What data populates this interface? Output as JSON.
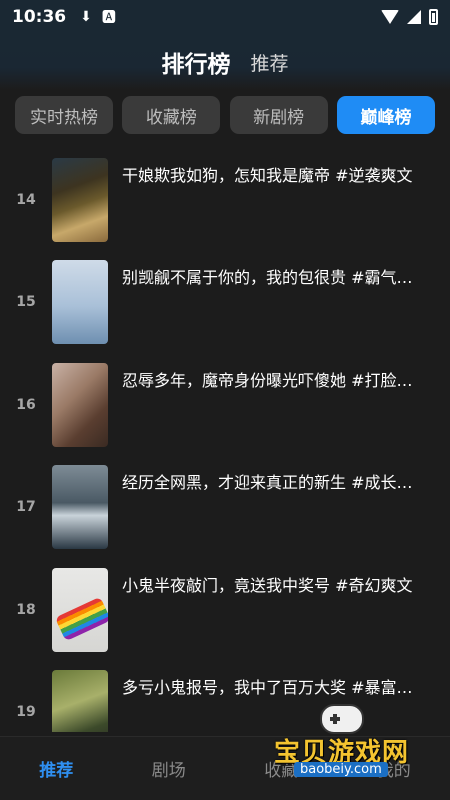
{
  "status": {
    "time": "10:36"
  },
  "header": {
    "title": "排行榜",
    "tab2": "推荐"
  },
  "chips": [
    {
      "label": "实时热榜",
      "active": false
    },
    {
      "label": "收藏榜",
      "active": false
    },
    {
      "label": "新剧榜",
      "active": false
    },
    {
      "label": "巅峰榜",
      "active": true
    }
  ],
  "list": [
    {
      "rank": "14",
      "title": "干娘欺我如狗，怎知我是魔帝 #逆袭爽文"
    },
    {
      "rank": "15",
      "title": "别觊觎不属于你的，我的包很贵 #霸气…"
    },
    {
      "rank": "16",
      "title": "忍辱多年，魔帝身份曝光吓傻她 #打脸…"
    },
    {
      "rank": "17",
      "title": "经历全网黑，才迎来真正的新生 #成长…"
    },
    {
      "rank": "18",
      "title": "小鬼半夜敲门，竟送我中奖号 #奇幻爽文"
    },
    {
      "rank": "19",
      "title": "多亏小鬼报号，我中了百万大奖 #暴富…"
    }
  ],
  "tabbar": [
    {
      "label": "推荐",
      "active": true
    },
    {
      "label": "剧场",
      "active": false
    },
    {
      "label": "收藏",
      "active": false
    },
    {
      "label": "我的",
      "active": false
    }
  ],
  "watermark": {
    "text": "宝贝游戏网",
    "url": "baobeiy.com"
  }
}
